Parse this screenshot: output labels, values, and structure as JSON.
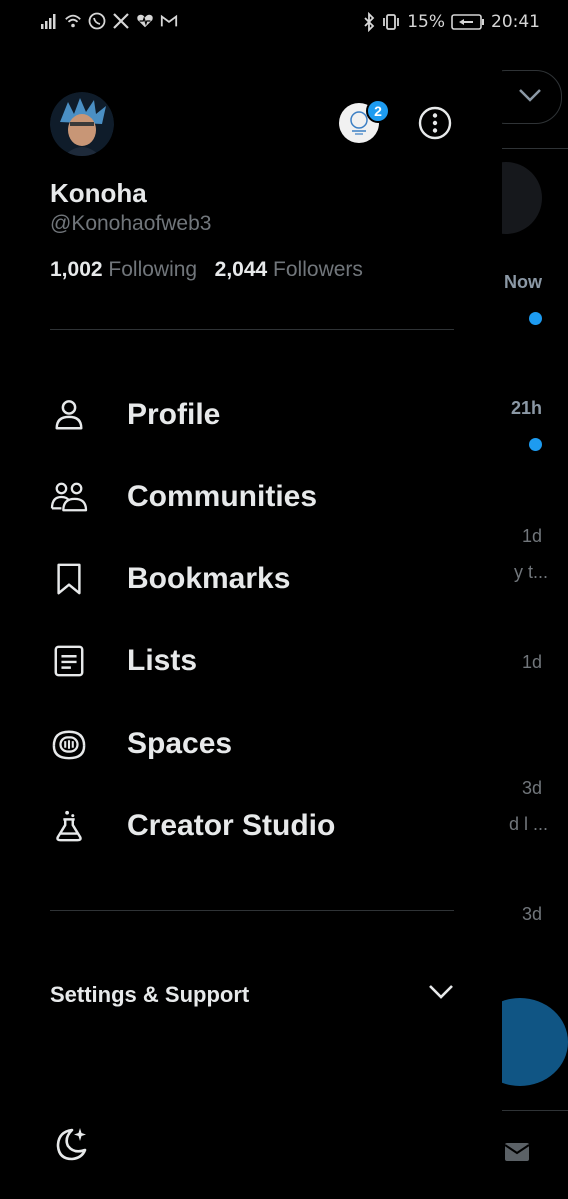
{
  "status_bar": {
    "battery": "15%",
    "time": "20:41",
    "left_icons": [
      "signal-icon",
      "wifi-icon",
      "whatsapp-icon",
      "x-app-icon",
      "health-icon",
      "gmail-icon"
    ],
    "right_icons": [
      "bluetooth-icon",
      "vibrate-icon",
      "battery-saver-icon"
    ]
  },
  "profile": {
    "name": "Konoha",
    "handle": "@Konohaofweb3",
    "following_count": "1,002",
    "following_label": "Following",
    "followers_count": "2,044",
    "followers_label": "Followers",
    "notification_badge": "2"
  },
  "nav": {
    "items": [
      {
        "label": "Profile",
        "icon": "person-icon"
      },
      {
        "label": "Communities",
        "icon": "communities-icon"
      },
      {
        "label": "Bookmarks",
        "icon": "bookmark-icon"
      },
      {
        "label": "Lists",
        "icon": "list-icon"
      },
      {
        "label": "Spaces",
        "icon": "spaces-icon"
      },
      {
        "label": "Creator Studio",
        "icon": "flask-icon"
      }
    ]
  },
  "settings": {
    "label": "Settings & Support"
  },
  "timeline_peek": {
    "times": [
      "Now",
      "21h",
      "1d",
      "1d",
      "3d",
      "3d"
    ],
    "snippets": [
      "y t...",
      "d l ..."
    ]
  },
  "colors": {
    "accent": "#1d9bf0",
    "background": "#000000",
    "text_primary": "#e7e9ea",
    "text_secondary": "#71767b",
    "divider": "#2f3336"
  }
}
